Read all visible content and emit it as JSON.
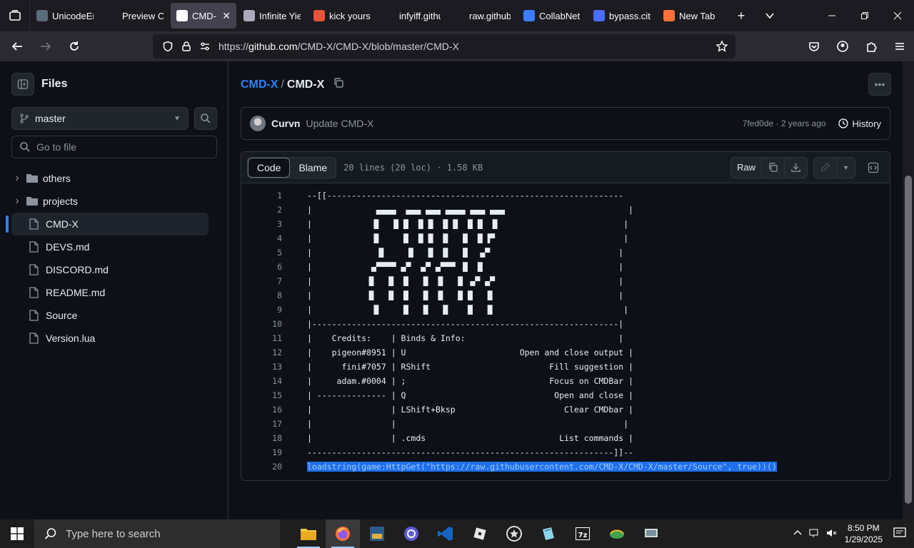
{
  "browser": {
    "tabs": [
      {
        "label": "UnicodeEr",
        "icon_color": "#5a6b7a"
      },
      {
        "label": "Preview Conte",
        "icon_color": "#1c1b22"
      },
      {
        "label": "CMD-",
        "icon_color": "#ffffff",
        "active": true
      },
      {
        "label": "Infinite Yie",
        "icon_color": "#aab"
      },
      {
        "label": "kick yours",
        "icon_color": "#e8533a"
      },
      {
        "label": "infyiff.github.i",
        "icon_color": "#1c1b22"
      },
      {
        "label": "raw.githubuser",
        "icon_color": "#1c1b22"
      },
      {
        "label": "CollabNet",
        "icon_color": "#3d7bff"
      },
      {
        "label": "bypass.city",
        "icon_color": "#4a6cff"
      },
      {
        "label": "New Tab",
        "icon_color": "#ff7139"
      }
    ],
    "close_glyph": "✕",
    "new_tab_glyph": "+",
    "url_prefix": "https://",
    "url_host": "github.com",
    "url_path": "/CMD-X/CMD-X/blob/master/CMD-X"
  },
  "sidebar": {
    "title": "Files",
    "branch": "master",
    "goto_placeholder": "Go to file",
    "items": [
      {
        "label": "others",
        "type": "folder"
      },
      {
        "label": "projects",
        "type": "folder"
      },
      {
        "label": "CMD-X",
        "type": "file",
        "selected": true
      },
      {
        "label": "DEVS.md",
        "type": "file"
      },
      {
        "label": "DISCORD.md",
        "type": "file"
      },
      {
        "label": "README.md",
        "type": "file"
      },
      {
        "label": "Source",
        "type": "file"
      },
      {
        "label": "Version.lua",
        "type": "file"
      }
    ]
  },
  "breadcrumb": {
    "owner": "CMD-X",
    "separator": "/",
    "file": "CMD-X"
  },
  "commit": {
    "author": "Curvn",
    "message": "Update CMD-X",
    "meta": "7fed0de · 2 years ago",
    "history_label": "History"
  },
  "file": {
    "tab_code": "Code",
    "tab_blame": "Blame",
    "info": "20 lines (20 loc) · 1.58 KB",
    "raw_label": "Raw"
  },
  "code_lines": [
    "--[[------------------------------------------------------------",
    "|             ▄▄▄▄  ▄▄▄ ▄▄▄ ▄▄▄▄ ▄▄▄ ▄▄▄                         |",
    "|            ▐▌  ▐▌▐▌ ▐▌▐▌ ▐▌▐▌ ▐▌▐▌ ▐▌                         |",
    "|            ▐▌    ▐▌ ▐▌▐▌ ▐▌  ▐▌ ▐▌▐▀                          |",
    "|             ▐▌    ▐▌  ▐▌ ▐▌  ▐▌  ▄▀                          |",
    "|            ▄▀▀▀▀ ▄▀  ▄▀ ▄▀▀▀ ▐▌ ▐▌                           |",
    "|           ▐▌  ▐▌ ▐▌  ▐▌ ▐▌  ▐▌ ▄▀ ▄▀                         |",
    "|           ▐▌  ▐▌ ▐▌  ▐▌ ▐▌  ▐▌▐▌  ▐▌                         |",
    "|            ▐▌    ▐▌  ▐▌  ▐▌   ▐▌  ▐▌                          |",
    "|--------------------------------------------------------------|",
    "|    Credits:    | Binds & Info:                               |",
    "|    pigeon#8951 | U                       Open and close output |",
    "|      fini#7057 | RShift                        Fill suggestion |",
    "|     adam.#0004 | ;                             Focus on CMDBar |",
    "| -------------- | Q                              Open and close |",
    "|                | LShift+Bksp                      Clear CMDbar |",
    "|                |                                              |",
    "|                | .cmds                           List commands |",
    "--------------------------------------------------------------]]--",
    "loadstring(game:HttpGet(\"https://raw.githubusercontent.com/CMD-X/CMD-X/master/Source\", true))()"
  ],
  "taskbar": {
    "search_placeholder": "Type here to search",
    "time": "8:50 PM",
    "date": "1/29/2025"
  }
}
